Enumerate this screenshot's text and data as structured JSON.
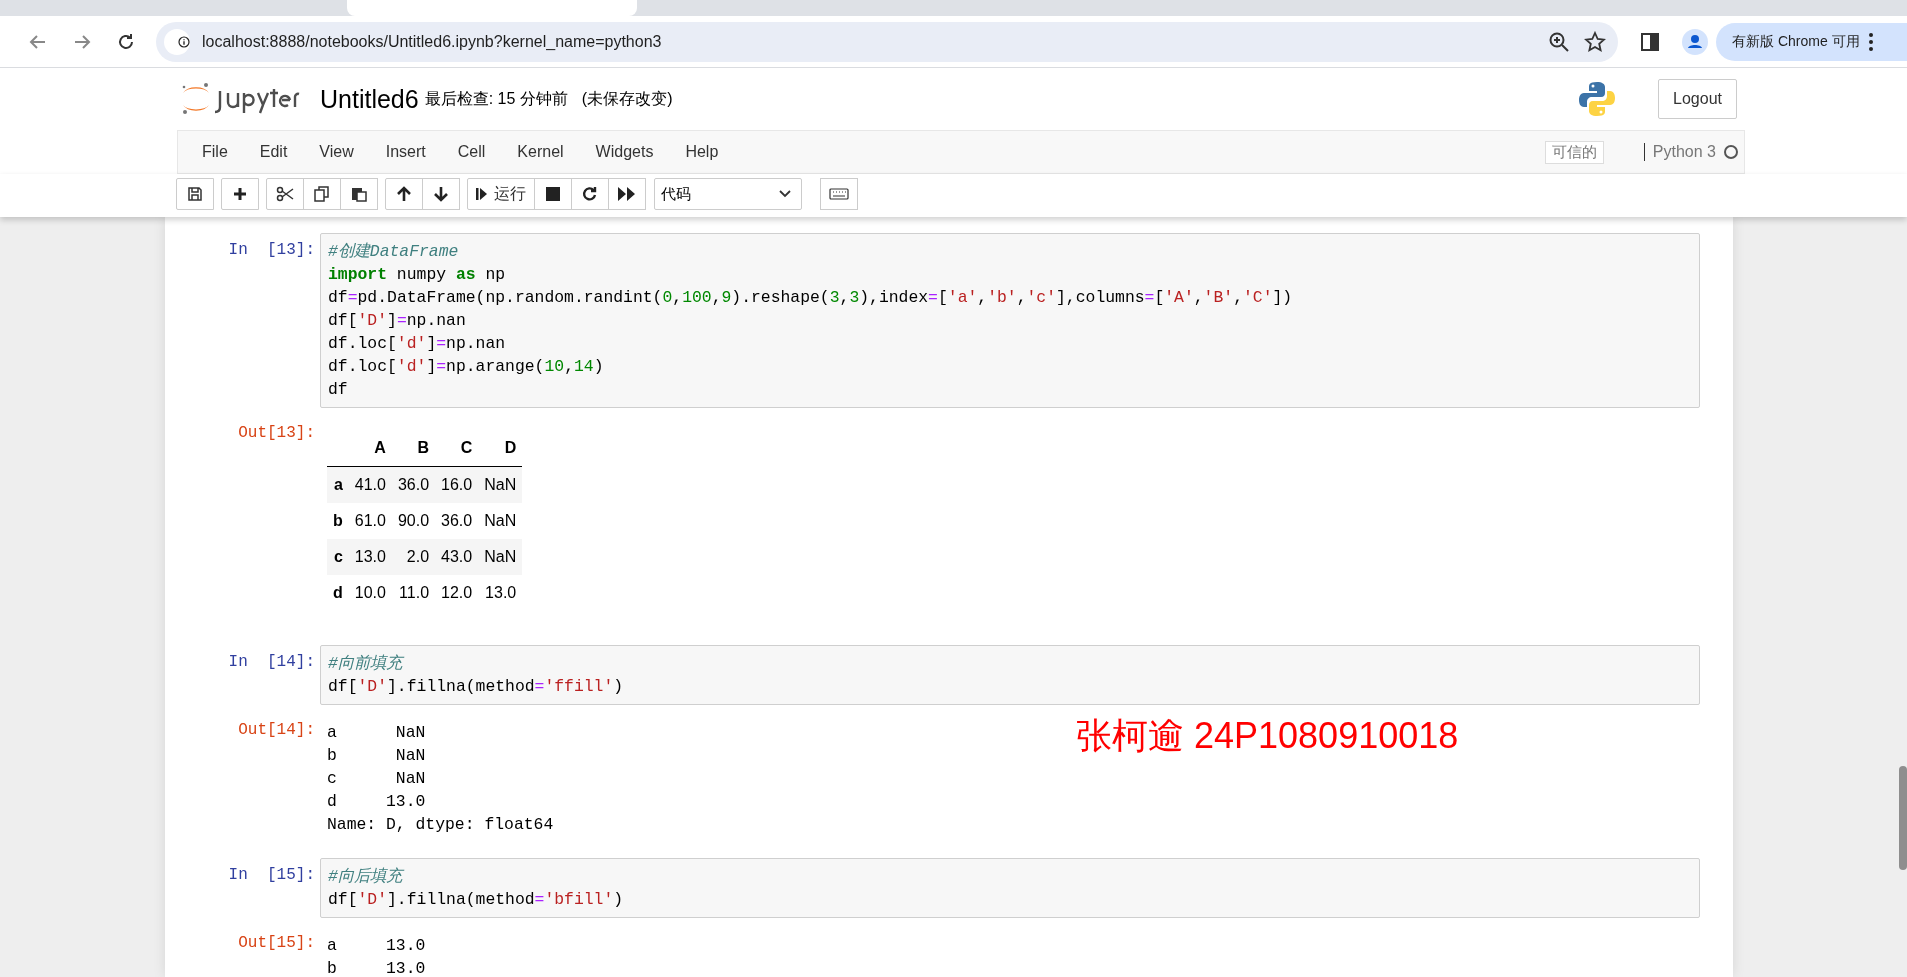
{
  "browser": {
    "url": "localhost:8888/notebooks/Untitled6.ipynb?kernel_name=python3",
    "update_chip": "有新版 Chrome 可用"
  },
  "header": {
    "notebook_name": "Untitled6",
    "checkpoint": "最后检查: 15 分钟前",
    "autosave": "(未保存改变)",
    "logout": "Logout"
  },
  "menubar": {
    "items": [
      "File",
      "Edit",
      "View",
      "Insert",
      "Cell",
      "Kernel",
      "Widgets",
      "Help"
    ],
    "trusted": "可信的",
    "kernel": "Python 3",
    "kernel_busy": false
  },
  "toolbar": {
    "run_label": "运行",
    "cell_type": "代码"
  },
  "cells": [
    {
      "kind": "input",
      "prompt": "In  [13]:",
      "lines": [
        [
          {
            "text": "#创建DataFrame",
            "kind": "comment"
          }
        ],
        [
          {
            "text": "import",
            "kind": "keyword"
          },
          {
            "text": " numpy ",
            "kind": "plain"
          },
          {
            "text": "as",
            "kind": "keyword"
          },
          {
            "text": " np",
            "kind": "plain"
          }
        ],
        [
          {
            "text": "df",
            "kind": "plain"
          },
          {
            "text": "=",
            "kind": "operator"
          },
          {
            "text": "pd.DataFrame(np.random.randint(",
            "kind": "plain"
          },
          {
            "text": "0",
            "kind": "number"
          },
          {
            "text": ",",
            "kind": "plain"
          },
          {
            "text": "100",
            "kind": "number"
          },
          {
            "text": ",",
            "kind": "plain"
          },
          {
            "text": "9",
            "kind": "number"
          },
          {
            "text": ").reshape(",
            "kind": "plain"
          },
          {
            "text": "3",
            "kind": "number"
          },
          {
            "text": ",",
            "kind": "plain"
          },
          {
            "text": "3",
            "kind": "number"
          },
          {
            "text": "),index",
            "kind": "plain"
          },
          {
            "text": "=",
            "kind": "operator"
          },
          {
            "text": "[",
            "kind": "plain"
          },
          {
            "text": "'a'",
            "kind": "string"
          },
          {
            "text": ",",
            "kind": "plain"
          },
          {
            "text": "'b'",
            "kind": "string"
          },
          {
            "text": ",",
            "kind": "plain"
          },
          {
            "text": "'c'",
            "kind": "string"
          },
          {
            "text": "],columns",
            "kind": "plain"
          },
          {
            "text": "=",
            "kind": "operator"
          },
          {
            "text": "[",
            "kind": "plain"
          },
          {
            "text": "'A'",
            "kind": "string"
          },
          {
            "text": ",",
            "kind": "plain"
          },
          {
            "text": "'B'",
            "kind": "string"
          },
          {
            "text": ",",
            "kind": "plain"
          },
          {
            "text": "'C'",
            "kind": "string"
          },
          {
            "text": "])",
            "kind": "plain"
          }
        ],
        [
          {
            "text": "df[",
            "kind": "plain"
          },
          {
            "text": "'D'",
            "kind": "string"
          },
          {
            "text": "]",
            "kind": "plain"
          },
          {
            "text": "=",
            "kind": "operator"
          },
          {
            "text": "np.nan",
            "kind": "plain"
          }
        ],
        [
          {
            "text": "df.loc[",
            "kind": "plain"
          },
          {
            "text": "'d'",
            "kind": "string"
          },
          {
            "text": "]",
            "kind": "plain"
          },
          {
            "text": "=",
            "kind": "operator"
          },
          {
            "text": "np.nan",
            "kind": "plain"
          }
        ],
        [
          {
            "text": "df.loc[",
            "kind": "plain"
          },
          {
            "text": "'d'",
            "kind": "string"
          },
          {
            "text": "]",
            "kind": "plain"
          },
          {
            "text": "=",
            "kind": "operator"
          },
          {
            "text": "np.arange(",
            "kind": "plain"
          },
          {
            "text": "10",
            "kind": "number"
          },
          {
            "text": ",",
            "kind": "plain"
          },
          {
            "text": "14",
            "kind": "number"
          },
          {
            "text": ")",
            "kind": "plain"
          }
        ],
        [
          {
            "text": "df",
            "kind": "plain"
          }
        ]
      ]
    },
    {
      "kind": "table",
      "prompt": "Out[13]:",
      "columns": [
        "A",
        "B",
        "C",
        "D"
      ],
      "rows": [
        {
          "index": "a",
          "values": [
            "41.0",
            "36.0",
            "16.0",
            "NaN"
          ]
        },
        {
          "index": "b",
          "values": [
            "61.0",
            "90.0",
            "36.0",
            "NaN"
          ]
        },
        {
          "index": "c",
          "values": [
            "13.0",
            "2.0",
            "43.0",
            "NaN"
          ]
        },
        {
          "index": "d",
          "values": [
            "10.0",
            "11.0",
            "12.0",
            "13.0"
          ]
        }
      ]
    },
    {
      "kind": "input",
      "prompt": "In  [14]:",
      "lines": [
        [
          {
            "text": "#向前填充",
            "kind": "comment"
          }
        ],
        [
          {
            "text": "df[",
            "kind": "plain"
          },
          {
            "text": "'D'",
            "kind": "string"
          },
          {
            "text": "].fillna(method",
            "kind": "plain"
          },
          {
            "text": "=",
            "kind": "operator"
          },
          {
            "text": "'ffill'",
            "kind": "string"
          },
          {
            "text": ")",
            "kind": "plain"
          }
        ]
      ]
    },
    {
      "kind": "text",
      "prompt": "Out[14]:",
      "lines": [
        "a      NaN",
        "b      NaN",
        "c      NaN",
        "d     13.0",
        "Name: D, dtype: float64"
      ]
    },
    {
      "kind": "input",
      "prompt": "In  [15]:",
      "lines": [
        [
          {
            "text": "#向后填充",
            "kind": "comment"
          }
        ],
        [
          {
            "text": "df[",
            "kind": "plain"
          },
          {
            "text": "'D'",
            "kind": "string"
          },
          {
            "text": "].fillna(method",
            "kind": "plain"
          },
          {
            "text": "=",
            "kind": "operator"
          },
          {
            "text": "'bfill'",
            "kind": "string"
          },
          {
            "text": ")",
            "kind": "plain"
          }
        ]
      ]
    },
    {
      "kind": "text",
      "prompt": "Out[15]:",
      "lines": [
        "a     13.0",
        "b     13.0"
      ]
    }
  ],
  "annotation": "张柯逾 24P1080910018"
}
